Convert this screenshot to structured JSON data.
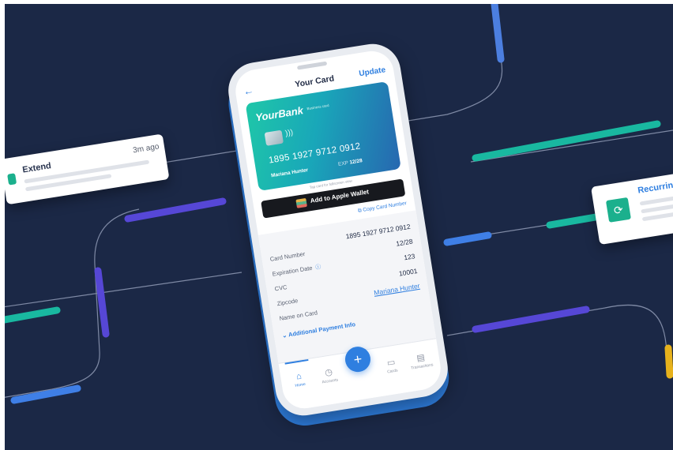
{
  "colors": {
    "background": "#1b2846",
    "accent": "#2f7fe0",
    "teal": "#1bb08d",
    "purple": "#5647d6",
    "yellow": "#e7b21c"
  },
  "header": {
    "title": "Your Card",
    "update_label": "Update",
    "back_icon": "arrow-left-icon"
  },
  "card": {
    "bank": "YourBank",
    "bank_sub": "Business card",
    "number": "1895 1927 9712 0912",
    "holder": "Mariana Hunter",
    "exp_label": "EXP",
    "exp_value": "12/28",
    "hint": "Tap card for fullscreen view"
  },
  "wallet": {
    "label": "Add to Apple Wallet",
    "copy_label": "Copy Card Number"
  },
  "details": {
    "labels": {
      "number": "Card Number",
      "expiration": "Expiration Date",
      "cvc": "CVC",
      "zipcode": "Zipcode",
      "name": "Name on Card"
    },
    "values": {
      "number": "1895 1927 9712 0912",
      "expiration": "12/28",
      "cvc": "123",
      "zipcode": "10001",
      "name": "Mariana Hunter"
    },
    "additional": "Additional Payment Info"
  },
  "nav": {
    "home": "Home",
    "accounts": "Accounts",
    "cards": "Cards",
    "transactions": "Transactions",
    "fab": "+"
  },
  "notifications": {
    "left": {
      "title": "Extend",
      "time": "3m ago"
    },
    "right": {
      "title": "Recurring"
    }
  }
}
